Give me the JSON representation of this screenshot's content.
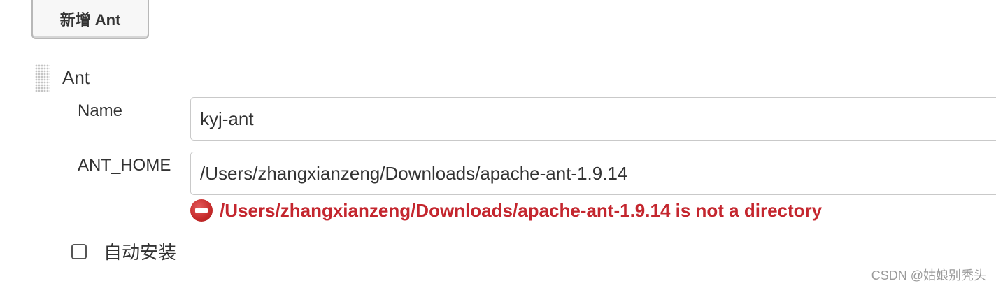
{
  "toolbar": {
    "add_button_label": "新增 Ant"
  },
  "section": {
    "title": "Ant"
  },
  "fields": {
    "name": {
      "label": "Name",
      "value": "kyj-ant"
    },
    "ant_home": {
      "label": "ANT_HOME",
      "value": "/Users/zhangxianzeng/Downloads/apache-ant-1.9.14",
      "error": "/Users/zhangxianzeng/Downloads/apache-ant-1.9.14 is not a directory"
    }
  },
  "auto_install": {
    "label": "自动安装",
    "checked": false
  },
  "watermark": "CSDN @姑娘别秃头",
  "colors": {
    "error": "#c4262e",
    "border": "#c9c9c9",
    "text": "#333333"
  },
  "icons": {
    "drag_handle": "drag-handle-icon",
    "error": "error-icon"
  }
}
